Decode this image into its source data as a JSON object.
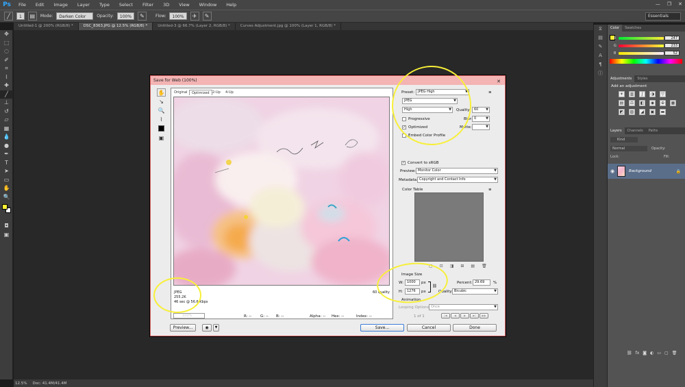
{
  "app": {
    "logo": "Ps"
  },
  "menu": [
    "File",
    "Edit",
    "Image",
    "Layer",
    "Type",
    "Select",
    "Filter",
    "3D",
    "View",
    "Window",
    "Help"
  ],
  "window_buttons": {
    "minimize": "—",
    "restore": "❐",
    "close": "✕"
  },
  "options_bar": {
    "mode_label": "Mode:",
    "mode_value": "Darken Color",
    "opacity_label": "Opacity:",
    "opacity_value": "100%",
    "flow_label": "Flow:",
    "flow_value": "100%",
    "brush_size": "1",
    "workspace": "Essentials"
  },
  "doc_tabs": [
    "Untitled-1 @ 200% (RGB/8) *",
    "DSC_8363.JPG @ 12.5% (RGB/8) *",
    "Untitled-3 @ 66.7% (Layer 2, RGB/8) *",
    "Curves Adjustment.jpg @ 100% (Layer 1, RGB/8) *"
  ],
  "status": {
    "zoom": "12.5%",
    "doc": "Doc: 41.4M/41.4M"
  },
  "color_panel": {
    "tabs": [
      "Color",
      "Swatches"
    ],
    "r_label": "R",
    "g_label": "G",
    "b_label": "B",
    "r": "247",
    "g": "233",
    "b": "52"
  },
  "adjustments_panel": {
    "tabs": [
      "Adjustments",
      "Styles"
    ],
    "title": "Add an adjustment"
  },
  "layers_panel": {
    "tabs": [
      "Layers",
      "Channels",
      "Paths"
    ],
    "kind": "Kind",
    "blend": "Normal",
    "opacity_label": "Opacity:",
    "lock_label": "Lock:",
    "fill_label": "Fill:",
    "layer_name": "Background"
  },
  "dialog": {
    "title": "Save for Web (100%)",
    "close": "✕",
    "view_tabs": [
      "Original",
      "Optimized",
      "2-Up",
      "4-Up"
    ],
    "preset_label": "Preset:",
    "preset_value": "JPEG High",
    "format": "JPEG",
    "quality_level": "High",
    "quality_label": "Quality:",
    "quality_value": "60",
    "progressive": "Progressive",
    "blur_label": "Blur:",
    "blur_value": "0",
    "optimized": "Optimized",
    "matte_label": "Matte:",
    "embed_profile": "Embed Color Profile",
    "convert_srgb": "Convert to sRGB",
    "preview_label": "Preview:",
    "preview_value": "Monitor Color",
    "metadata_label": "Metadata:",
    "metadata_value": "Copyright and Contact Info",
    "color_table": "Color Table",
    "image_size": "Image Size",
    "w_label": "W:",
    "w_value": "1000",
    "px": "px",
    "h_label": "H:",
    "h_value": "1276",
    "percent_label": "Percent:",
    "percent_value": "29.69",
    "percent_unit": "%",
    "quality2_label": "Quality:",
    "quality2_value": "Bicubic",
    "animation": "Animation",
    "looping_label": "Looping Options:",
    "looping_value": "Once",
    "frame_count": "1 of 1",
    "info_format": "JPEG",
    "info_size": "255.2K",
    "info_time": "46 sec @ 56.6 Kbps",
    "info_quality": "60 quality",
    "readout": [
      "R: --",
      "G: --",
      "B: --",
      "Alpha: --",
      "Hex: --",
      "Index: --"
    ],
    "zoom_value": "100%",
    "buttons": {
      "preview": "Preview...",
      "save": "Save...",
      "cancel": "Cancel",
      "done": "Done"
    }
  },
  "accent_colors": {
    "foreground": "#f7ef34",
    "annotation": "#f7ef37",
    "dialog_frame": "#f4b4b4"
  }
}
